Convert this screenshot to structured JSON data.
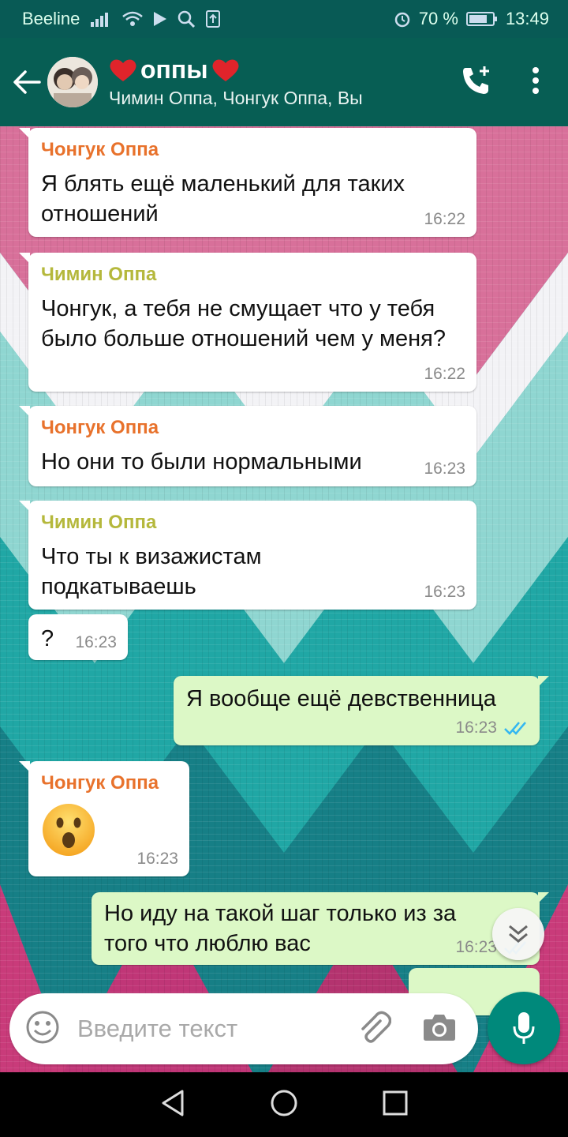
{
  "status_bar": {
    "carrier": "Beeline",
    "battery": "70 %",
    "time": "13:49"
  },
  "header": {
    "title": "оппы",
    "title_emoji": "heart-emoji",
    "subtitle": "Чимин Оппа, Чонгук Оппа, Вы"
  },
  "messages": [
    {
      "sender": "Чонгук Оппа",
      "text": "Я блять ещё маленький для таких отношений",
      "time": "16:22",
      "direction": "in"
    },
    {
      "sender": "Чимин Оппа",
      "text": "Чонгук, а тебя не смущает что у тебя было больше отношений чем у меня?",
      "time": "16:22",
      "direction": "in"
    },
    {
      "sender": "Чонгук Оппа",
      "text": "Но они то были нормальными",
      "time": "16:23",
      "direction": "in"
    },
    {
      "sender": "Чимин Оппа",
      "text": "Что ты к  визажистам подкатываешь",
      "time": "16:23",
      "direction": "in"
    },
    {
      "sender": "",
      "text": "?",
      "time": "16:23",
      "direction": "in"
    },
    {
      "sender": "",
      "text": "Я вообще ещё девственница",
      "time": "16:23",
      "direction": "out",
      "status": "read"
    },
    {
      "sender": "Чонгук Оппа",
      "text": "😮",
      "time": "16:23",
      "direction": "in"
    },
    {
      "sender": "",
      "text": "Но иду на такой шаг только из за того что люблю вас",
      "time": "16:23",
      "direction": "out",
      "status": "read"
    }
  ],
  "composer": {
    "placeholder": "Введите текст"
  },
  "colors": {
    "header": "#075e54",
    "statusbar": "#085a55",
    "outgoing_bubble": "#dcf8c6",
    "incoming_bubble": "#ffffff",
    "sender_jungkook": "#e8722c",
    "sender_jimin": "#b5b83c",
    "mic_button": "#00897b",
    "read_ticks": "#34b7f1"
  },
  "icons": [
    "back-arrow-icon",
    "add-call-icon",
    "more-options-icon",
    "emoji-icon",
    "attach-icon",
    "camera-icon",
    "mic-icon",
    "scroll-down-icon",
    "nav-back-icon",
    "nav-home-icon",
    "nav-recents-icon"
  ]
}
